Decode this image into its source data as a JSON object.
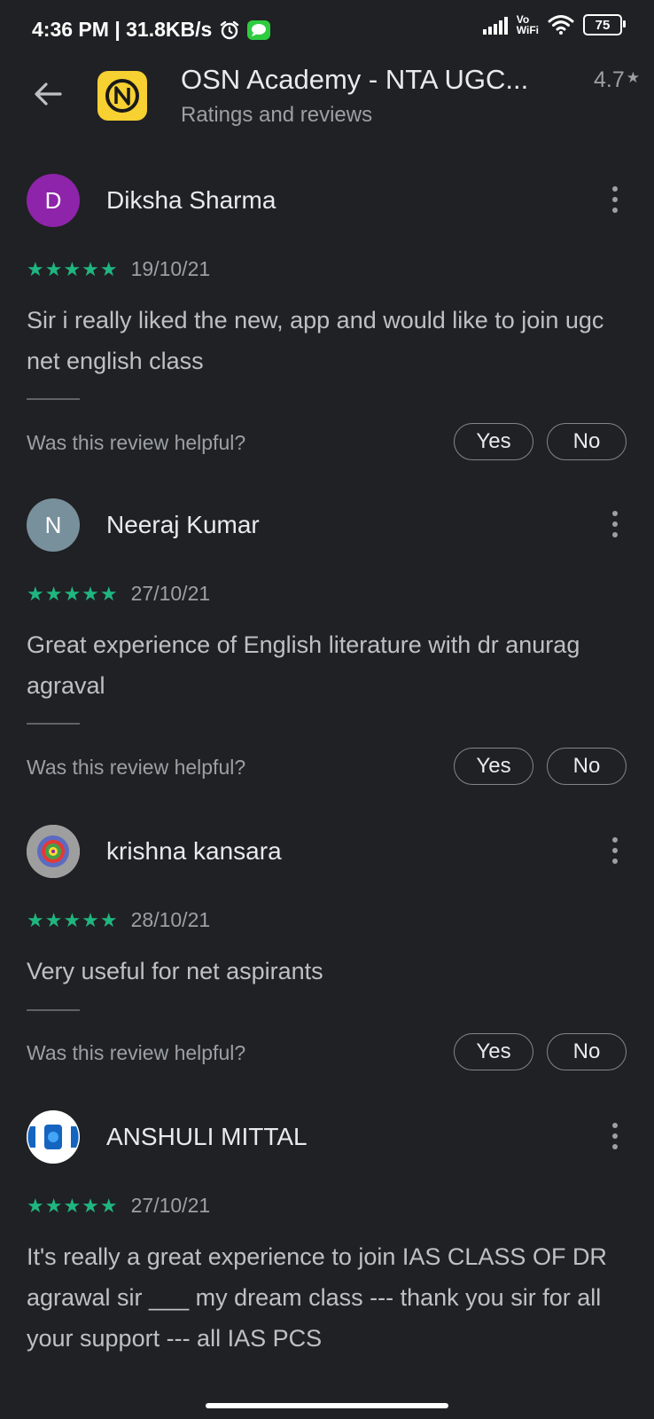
{
  "status_bar": {
    "time_speed": "4:36 PM | 31.8KB/s",
    "network_top": "Vo",
    "network_bottom": "WiFi",
    "battery": "75"
  },
  "header": {
    "app_title": "OSN Academy - NTA UGC...",
    "subtitle": "Ratings and reviews",
    "rating": "4.7"
  },
  "colors": {
    "background": "#202124",
    "star_green": "#1fb680",
    "logo_yellow": "#f7d031"
  },
  "helpful": {
    "question": "Was this review helpful?",
    "yes_label": "Yes",
    "no_label": "No"
  },
  "reviews": [
    {
      "avatar_letter": "D",
      "avatar_color": "#8e24aa",
      "name": "Diksha Sharma",
      "stars": "★★★★★",
      "rating": 5,
      "date": "19/10/21",
      "text": "Sir i really liked the new, app and would like to join ugc net english class"
    },
    {
      "avatar_letter": "N",
      "avatar_color": "#78909c",
      "name": "Neeraj Kumar",
      "stars": "★★★★★",
      "rating": 5,
      "date": "27/10/21",
      "text": "Great experience of English literature with dr anurag agraval"
    },
    {
      "avatar_letter": "",
      "avatar_color": "#bdbdbd",
      "name": "krishna kansara",
      "stars": "★★★★★",
      "rating": 5,
      "date": "28/10/21",
      "text": "Very useful for net aspirants"
    },
    {
      "avatar_letter": "",
      "avatar_color": "#ffffff",
      "name": "ANSHULI MITTAL",
      "stars": "★★★★★",
      "rating": 5,
      "date": "27/10/21",
      "text": "It's really a great experience to join IAS CLASS OF DR agrawal sir ___ my dream class --- thank you sir for all your support --- all IAS PCS"
    }
  ]
}
